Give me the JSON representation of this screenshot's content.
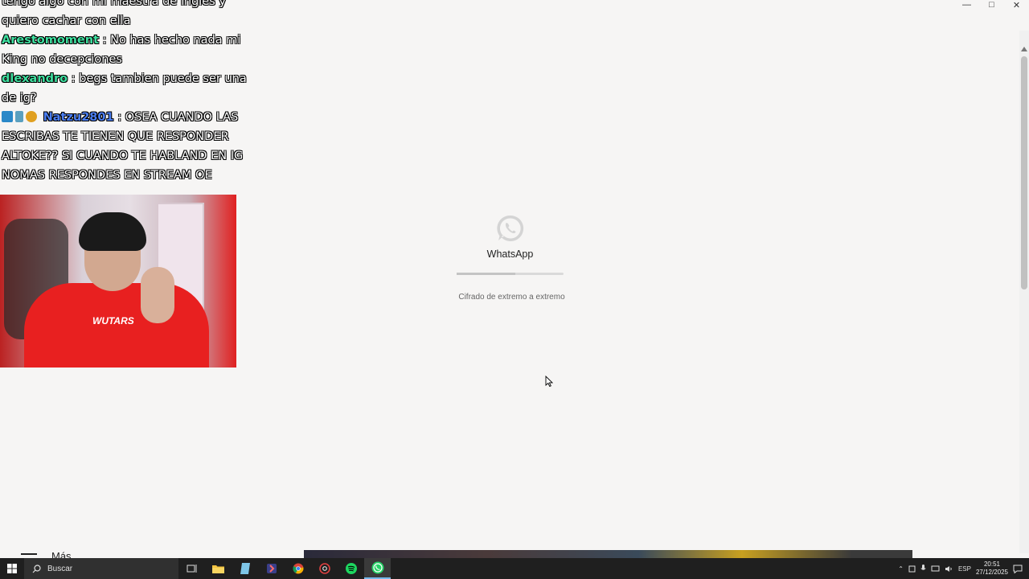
{
  "chat": [
    {
      "user": "",
      "text": "tengo algo con mi maestra de ingles y quiero cachar con ella",
      "user_color": ""
    },
    {
      "user": "Arestomoment",
      "text": ": No has hecho nada mi King no decepciones",
      "user_color": "#3fe0a0"
    },
    {
      "user": "dlexandro",
      "text": ": begs tambien puede ser una de ig?",
      "user_color": "#3fe0a0"
    },
    {
      "user": "Natzu2801",
      "text": ": OSEA CUANDO LAS ESCRIBAS TE TIENEN QUE RESPONDER ALTOKE?? SI CUANDO TE HABLAND EN IG NOMAS RESPONDES EN STREAM OE",
      "user_color": "#4a7df0"
    }
  ],
  "webcam": {
    "shirt_text": "WUTARS"
  },
  "loader": {
    "title": "WhatsApp",
    "progress": 0.55,
    "encryption_note": "Cifrado de extremo a extremo"
  },
  "strip": {
    "mas_label": "Más"
  },
  "taskbar": {
    "search_placeholder": "Buscar",
    "apps": [
      "task-view",
      "file-explorer",
      "notepad",
      "app-pin",
      "chrome",
      "chrome-dev",
      "spotify",
      "whatsapp"
    ],
    "active_app": "whatsapp",
    "language": "ESP",
    "time": "20:51",
    "date": "27/12/2025"
  },
  "colors": {
    "accent": "#25d366",
    "background": "#f6f5f4",
    "taskbar": "#1f1f1f"
  }
}
